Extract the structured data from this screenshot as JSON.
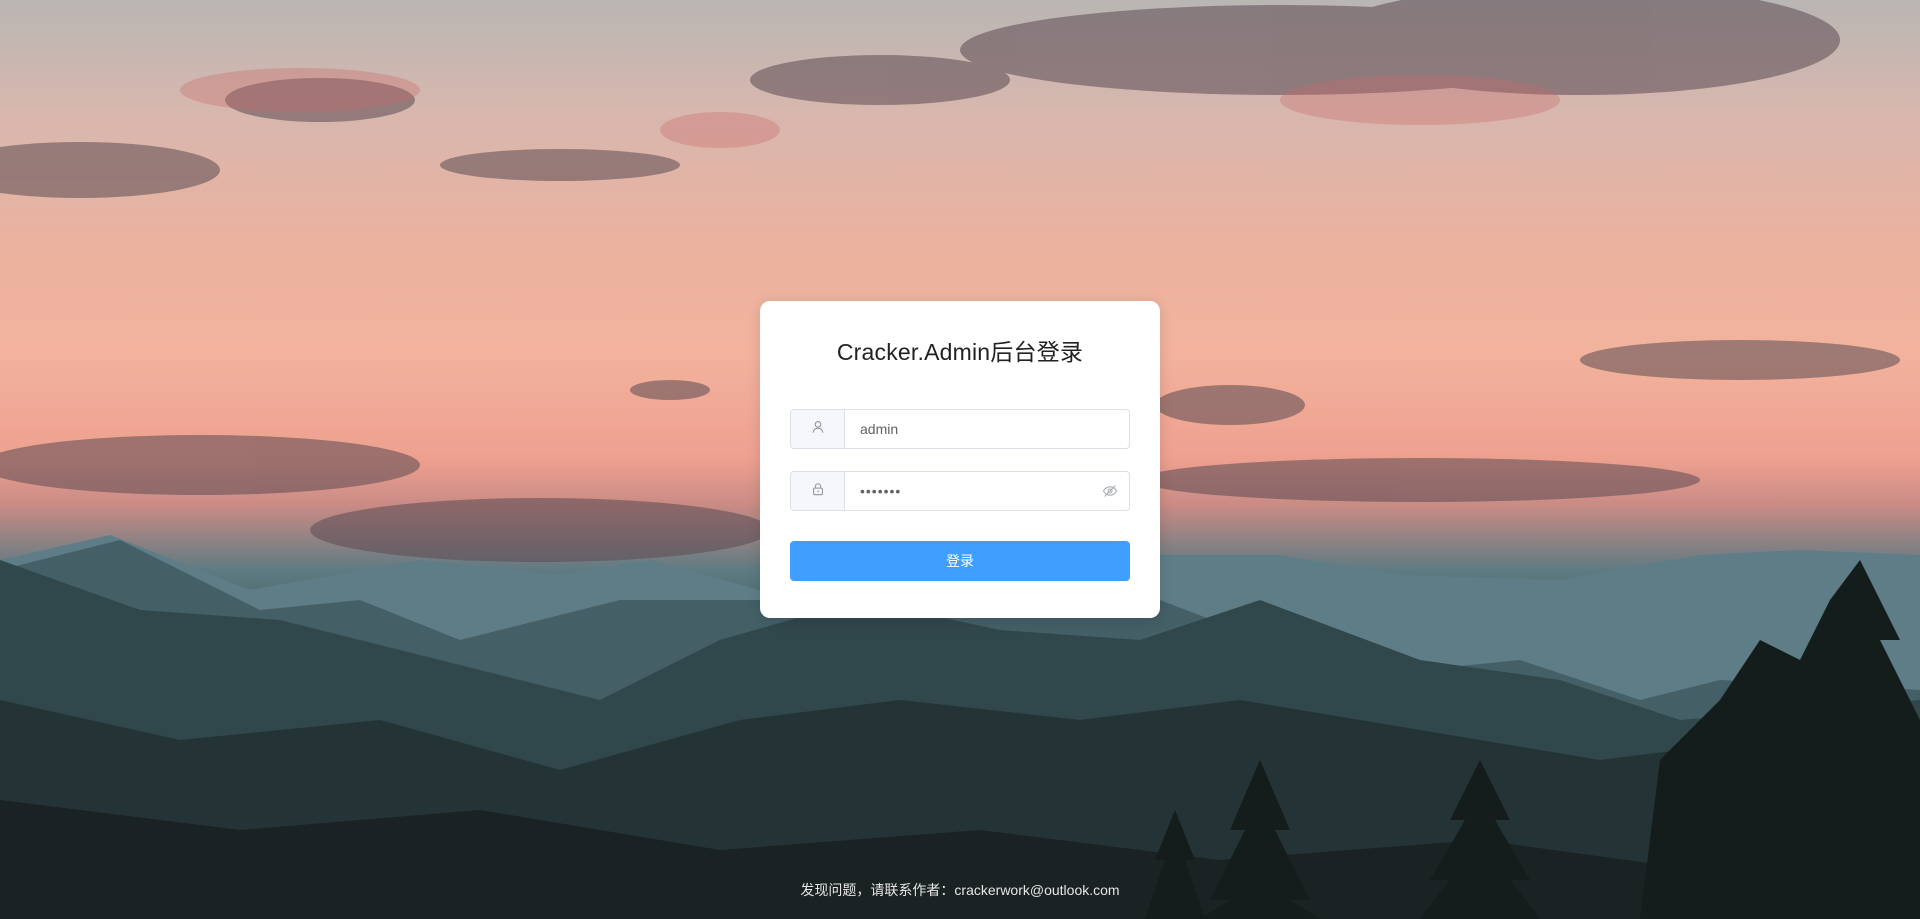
{
  "login": {
    "title": "Cracker.Admin后台登录",
    "username_value": "admin",
    "password_value": "1234567",
    "submit_label": "登录"
  },
  "icons": {
    "username": "user-icon",
    "password": "lock-icon",
    "toggle_password": "eye-off-icon"
  },
  "footer": {
    "text": "发现问题，请联系作者：crackerwork@outlook.com"
  },
  "colors": {
    "primary": "#409eff",
    "card_background": "#ffffff",
    "border": "#dcdfe6",
    "prepend_background": "#f5f7fa"
  }
}
